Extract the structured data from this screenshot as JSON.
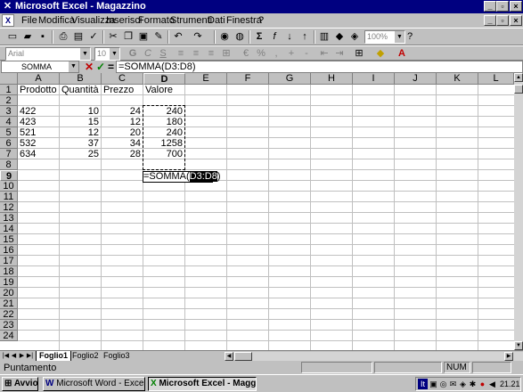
{
  "window": {
    "title": "Microsoft Excel - Magazzino"
  },
  "menu": [
    "File",
    "Modifica",
    "Visualizza",
    "Inserisci",
    "Formato",
    "Strumenti",
    "Dati",
    "Finestra",
    "?"
  ],
  "toolbar": {
    "zoom": "100%"
  },
  "format_bar": {
    "font": "Arial",
    "size": "10"
  },
  "formula_bar": {
    "name_box": "SOMMA",
    "content": "=SOMMA(D3:D8)",
    "cancel": "✕",
    "confirm": "✓",
    "equals": "="
  },
  "columns": [
    "A",
    "B",
    "C",
    "D",
    "E",
    "F",
    "G",
    "H",
    "I",
    "J",
    "K",
    "L"
  ],
  "rows": [
    "1",
    "2",
    "3",
    "4",
    "5",
    "6",
    "7",
    "8",
    "9",
    "10",
    "11",
    "12",
    "13",
    "14",
    "15",
    "16",
    "17",
    "18",
    "19",
    "20",
    "21",
    "22",
    "23",
    "24"
  ],
  "cells": {
    "header": [
      "Prodotto",
      "Quantità",
      "Prezzo",
      "Valore"
    ],
    "data": [
      [
        "422",
        "10",
        "24",
        "240"
      ],
      [
        "423",
        "15",
        "12",
        "180"
      ],
      [
        "521",
        "12",
        "20",
        "240"
      ],
      [
        "532",
        "37",
        "34",
        "1258"
      ],
      [
        "634",
        "25",
        "28",
        "700"
      ]
    ],
    "edit_prefix": "=SOMMA(",
    "edit_ref": "D3:D8",
    "edit_suffix": ")"
  },
  "sheets": [
    "Foglio1",
    "Foglio2",
    "Foglio3"
  ],
  "status": {
    "mode": "Puntamento",
    "num": "NUM"
  },
  "taskbar": {
    "start": "Avvio",
    "word": "Microsoft Word - Excel",
    "excel": "Microsoft Excel - Magg...",
    "clock": "21.21"
  }
}
